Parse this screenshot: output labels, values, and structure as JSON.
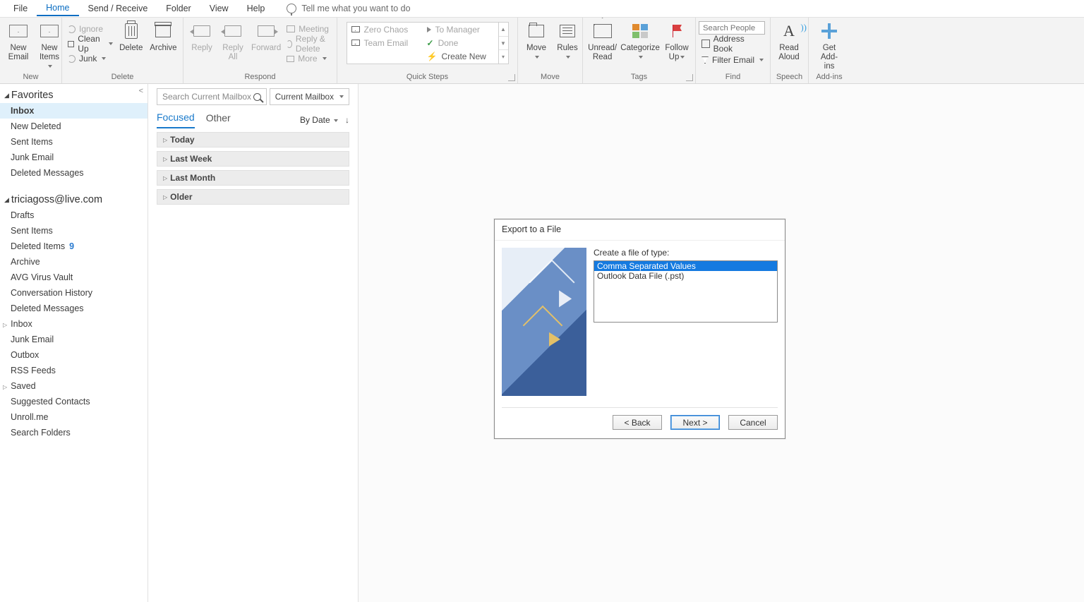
{
  "tabs": {
    "file": "File",
    "home": "Home",
    "send": "Send / Receive",
    "folder": "Folder",
    "view": "View",
    "help": "Help",
    "tellme": "Tell me what you want to do"
  },
  "ribbon": {
    "new": {
      "email": "New\nEmail",
      "items": "New\nItems",
      "label": "New"
    },
    "delete": {
      "ignore": "Ignore",
      "cleanup": "Clean Up",
      "junk": "Junk",
      "delete": "Delete",
      "archive": "Archive",
      "label": "Delete"
    },
    "respond": {
      "reply": "Reply",
      "replyall": "Reply\nAll",
      "forward": "Forward",
      "meeting": "Meeting",
      "replydel": "Reply & Delete",
      "more": "More",
      "label": "Respond"
    },
    "quicksteps": {
      "zero": "Zero Chaos",
      "team": "Team Email",
      "tomgr": "To Manager",
      "done": "Done",
      "create": "Create New",
      "label": "Quick Steps"
    },
    "move": {
      "move": "Move",
      "rules": "Rules",
      "label": "Move"
    },
    "tags": {
      "unread": "Unread/\nRead",
      "categorize": "Categorize",
      "followup": "Follow\nUp",
      "label": "Tags"
    },
    "find": {
      "search_placeholder": "Search People",
      "address": "Address Book",
      "filter": "Filter Email",
      "label": "Find"
    },
    "speech": {
      "read": "Read\nAloud",
      "label": "Speech"
    },
    "addins": {
      "get": "Get\nAdd-ins",
      "label": "Add-ins"
    }
  },
  "nav": {
    "favorites": "Favorites",
    "fav_items": [
      "Inbox",
      "New Deleted",
      "Sent Items",
      "Junk Email",
      "Deleted Messages"
    ],
    "account": "triciagoss@live.com",
    "acct_items": [
      {
        "label": "Drafts"
      },
      {
        "label": "Sent Items"
      },
      {
        "label": "Deleted Items",
        "count": "9"
      },
      {
        "label": "Archive"
      },
      {
        "label": "AVG Virus Vault"
      },
      {
        "label": "Conversation History"
      },
      {
        "label": "Deleted Messages"
      },
      {
        "label": "Inbox",
        "expandable": true
      },
      {
        "label": "Junk Email"
      },
      {
        "label": "Outbox"
      },
      {
        "label": "RSS Feeds"
      },
      {
        "label": "Saved",
        "expandable": true
      },
      {
        "label": "Suggested Contacts"
      },
      {
        "label": "Unroll.me"
      },
      {
        "label": "Search Folders"
      }
    ]
  },
  "msglist": {
    "search_placeholder": "Search Current Mailbox",
    "scope": "Current Mailbox",
    "tabs": {
      "focused": "Focused",
      "other": "Other"
    },
    "sort": "By Date",
    "groups": [
      "Today",
      "Last Week",
      "Last Month",
      "Older"
    ]
  },
  "dialog": {
    "title": "Export to a File",
    "label": "Create a file of type:",
    "options": [
      "Comma Separated Values",
      "Outlook Data File (.pst)"
    ],
    "back": "<  Back",
    "next": "Next  >",
    "cancel": "Cancel"
  }
}
